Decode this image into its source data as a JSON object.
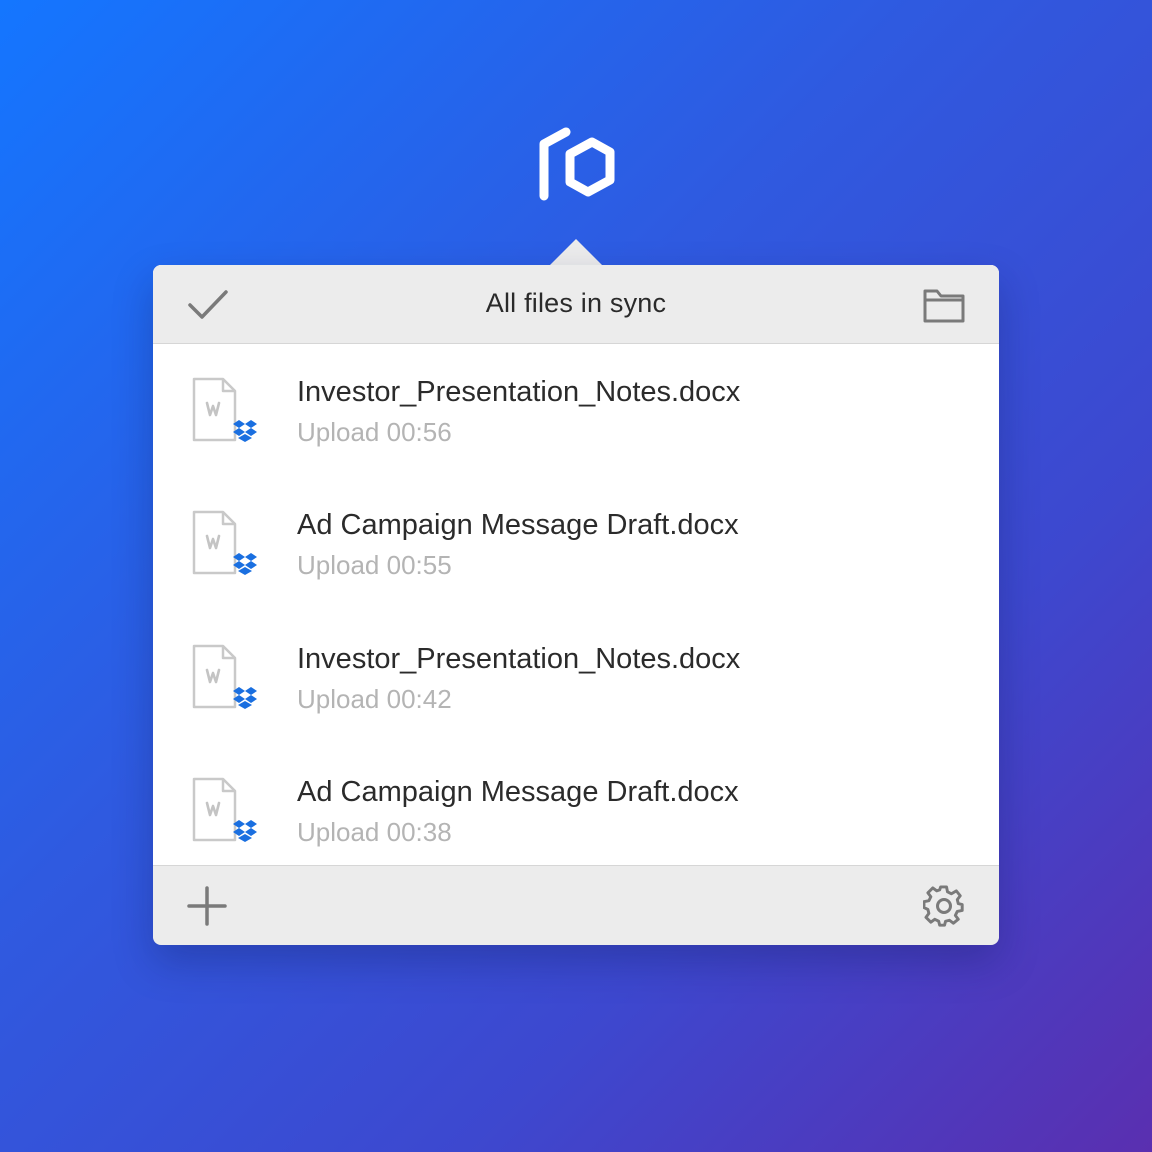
{
  "header": {
    "title": "All files in sync",
    "status_icon": "checkmark-icon",
    "folder_icon": "folder-icon"
  },
  "files": [
    {
      "name": "Investor_Presentation_Notes.docx",
      "status": "Upload 00:56",
      "icon": "word-document-icon"
    },
    {
      "name": "Ad Campaign Message Draft.docx",
      "status": "Upload 00:55",
      "icon": "word-document-icon"
    },
    {
      "name": "Investor_Presentation_Notes.docx",
      "status": "Upload 00:42",
      "icon": "word-document-icon"
    },
    {
      "name": "Ad Campaign Message Draft.docx",
      "status": "Upload 00:38",
      "icon": "word-document-icon"
    }
  ],
  "footer": {
    "add_icon": "plus-icon",
    "settings_icon": "gear-icon"
  },
  "colors": {
    "accent": "#1476ff",
    "background_end": "#5a2fb0",
    "panel_bar": "#ececec",
    "dropbox_blue": "#1a6fe0"
  }
}
